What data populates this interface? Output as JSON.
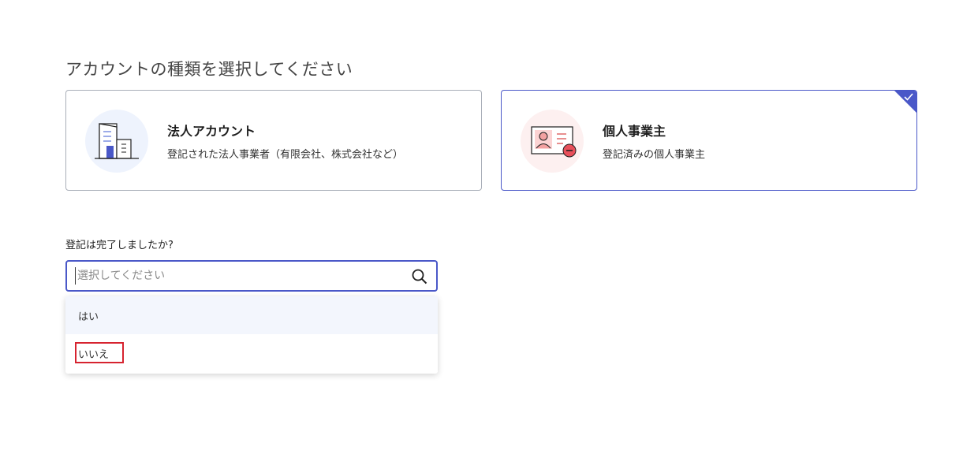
{
  "heading": "アカウントの種類を選択してください",
  "cards": {
    "corporate": {
      "title": "法人アカウント",
      "description": "登記された法人事業者（有限会社、株式会社など）",
      "icon": "building-icon",
      "selected": false
    },
    "sole_proprietor": {
      "title": "個人事業主",
      "description": "登記済みの個人事業主",
      "icon": "id-card-icon",
      "selected": true
    }
  },
  "registration": {
    "question": "登記は完了しましたか?",
    "placeholder": "選択してください",
    "value": "",
    "options": [
      {
        "label": "はい",
        "hovered": true
      },
      {
        "label": "いいえ",
        "highlighted": true
      }
    ]
  },
  "colors": {
    "accent": "#4a58c8",
    "highlight": "#d6232f",
    "option_hover": "#f3f6fd",
    "card_border": "#a9aeb8"
  }
}
